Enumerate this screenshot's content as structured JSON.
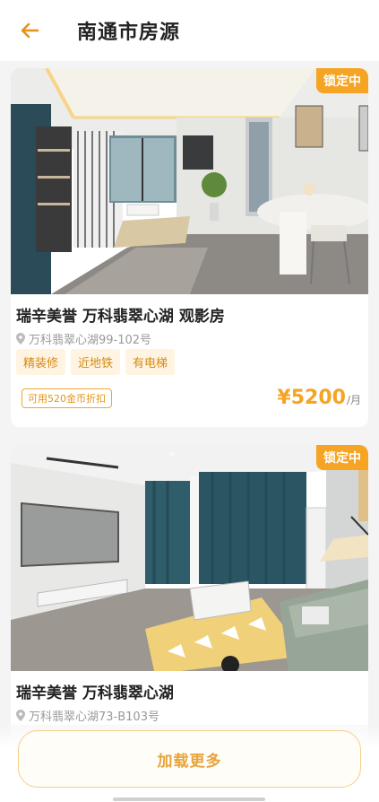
{
  "header": {
    "title": "南通市房源",
    "back_icon": "arrow-left-icon"
  },
  "listings": [
    {
      "badge": "锁定中",
      "name": "瑞辛美誉 万科翡翠心湖 观影房",
      "address": "万科翡翠心湖99-102号",
      "tags": [
        "精装修",
        "近地铁",
        "有电梯"
      ],
      "coupon": "可用520金币折扣",
      "price": "¥5200",
      "price_unit": "/月"
    },
    {
      "badge": "锁定中",
      "name": "瑞辛美誉 万科翡翠心湖",
      "address": "万科翡翠心湖73-B103号"
    }
  ],
  "load_more_label": "加载更多",
  "colors": {
    "accent": "#f5a423",
    "tag_bg": "#fff4e2",
    "tag_text": "#d78a11"
  }
}
